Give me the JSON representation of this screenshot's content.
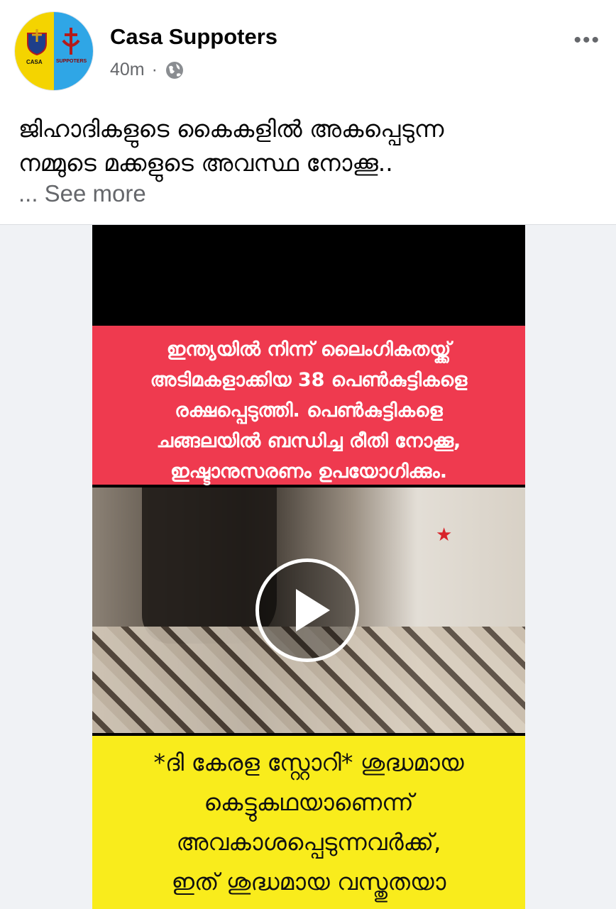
{
  "post": {
    "page_name": "Casa Suppoters",
    "time": "40m",
    "dot": "·",
    "privacy_icon": "globe-icon",
    "more_icon": "more-options-icon",
    "more_glyph": "•••",
    "text_line1": "ജിഹാദികളുടെ കൈകളിൽ അകപ്പെടുന്ന",
    "text_line2": "നമ്മുടെ മക്കളുടെ അവസ്ഥ നോക്കൂ..",
    "see_more": "... See more",
    "avatar": {
      "left_label": "CASA",
      "right_label": "SUPPOTERS",
      "colors": [
        "#f4d400",
        "#2fa6e6"
      ]
    }
  },
  "video": {
    "top_text": [
      "ഇന്ത്യയിൽ നിന്ന് ലൈംഗികതയ്ക്ക്",
      "അടിമകളാക്കിയ 38 പെൺകുട്ടികളെ",
      "രക്ഷപ്പെടുത്തി. പെൺകുട്ടികളെ",
      "ചങ്ങലയിൽ ബന്ധിച്ച രീതി നോക്കൂ,",
      "ഇഷ്ടാനുസരണം ഉപയോഗിക്കും."
    ],
    "bottom_text": [
      "*ദി കേരള സ്റ്റോറി* ശുദ്ധമായ",
      "കെട്ടുകഥയാണെന്ന്",
      "അവകാശപ്പെടുന്നവർക്ക്,",
      "ഇത് ശുദ്ധമായ വസ്തുതയാ"
    ],
    "play_icon": "play-icon",
    "colors": {
      "red_banner": "#ef3a4f",
      "yellow_banner": "#f9ec1c"
    }
  }
}
